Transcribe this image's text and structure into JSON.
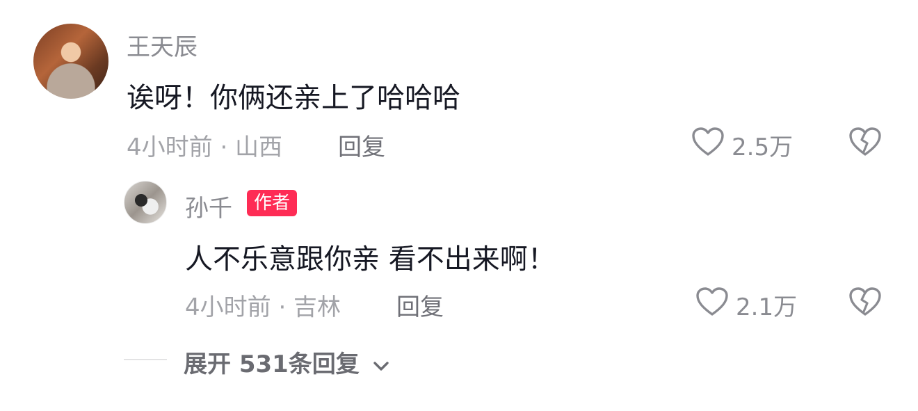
{
  "comment": {
    "username": "王天辰",
    "text": "诶呀！你俩还亲上了哈哈哈",
    "meta": "4小时前 · 山西",
    "reply_label": "回复",
    "like_count": "2.5万"
  },
  "reply": {
    "username": "孙千",
    "badge": "作者",
    "text": "人不乐意跟你亲 看不出来啊！",
    "meta": "4小时前 · 吉林",
    "reply_label": "回复",
    "like_count": "2.1万"
  },
  "expand": {
    "label": "展开 531条回复"
  },
  "colors": {
    "badge": "#fe2c55",
    "icon": "#8a8b91"
  },
  "icons": {
    "like": "heart-outline-icon",
    "dislike": "broken-heart-icon",
    "expand": "chevron-down-icon"
  }
}
